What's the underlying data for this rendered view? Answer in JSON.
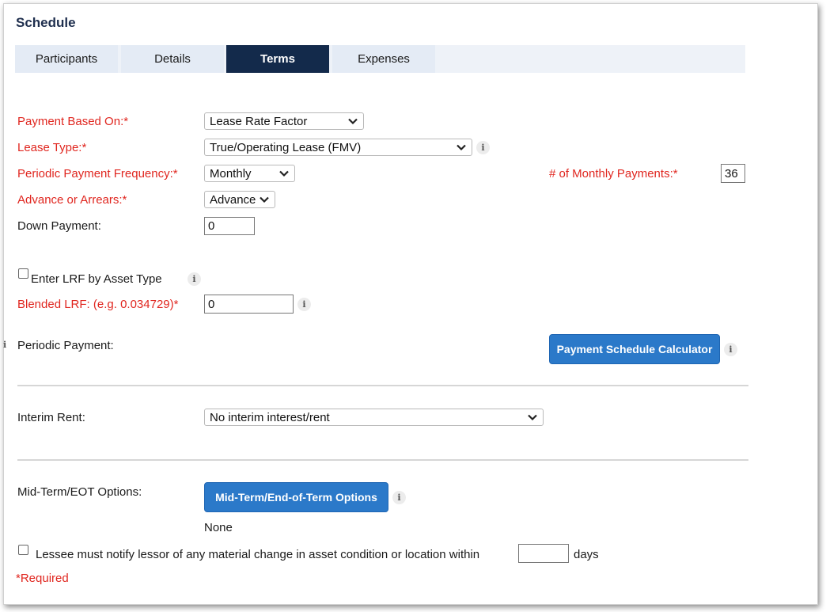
{
  "page": {
    "title": "Schedule"
  },
  "tabs": [
    {
      "label": "Participants"
    },
    {
      "label": "Details"
    },
    {
      "label": "Terms"
    },
    {
      "label": "Expenses"
    }
  ],
  "form": {
    "payment_based_on": {
      "label": "Payment Based On:*",
      "value": "Lease Rate Factor"
    },
    "lease_type": {
      "label": "Lease Type:*",
      "value": "True/Operating Lease (FMV)"
    },
    "periodic_frequency": {
      "label": "Periodic Payment Frequency:*",
      "value": "Monthly"
    },
    "num_payments": {
      "label": "# of Monthly Payments:*",
      "value": "36"
    },
    "advance_arrears": {
      "label": "Advance or Arrears:*",
      "value": "Advance"
    },
    "down_payment": {
      "label": "Down Payment:",
      "value": "0"
    },
    "enter_lrf": {
      "label": "Enter LRF by Asset Type",
      "checked": false
    },
    "blended_lrf": {
      "label": "Blended LRF: (e.g. 0.034729)*",
      "value": "0"
    },
    "periodic_payment": {
      "label": "Periodic Payment:"
    },
    "calc_button": "Payment Schedule Calculator",
    "interim_rent": {
      "label": "Interim Rent:",
      "value": "No interim interest/rent"
    },
    "midterm": {
      "label": "Mid-Term/EOT Options:",
      "button": "Mid-Term/End-of-Term Options",
      "value": "None"
    },
    "notify": {
      "text": "Lessee must notify lessor of any material change in asset condition or location within",
      "suffix": "days",
      "value": "",
      "checked": false
    },
    "required_note": "*Required"
  },
  "icons": {
    "info": "i",
    "chevron": "chevron-down-icon"
  },
  "colors": {
    "accent": "#2b79c9",
    "tab_active": "#132a4b",
    "required": "#e0261f"
  }
}
